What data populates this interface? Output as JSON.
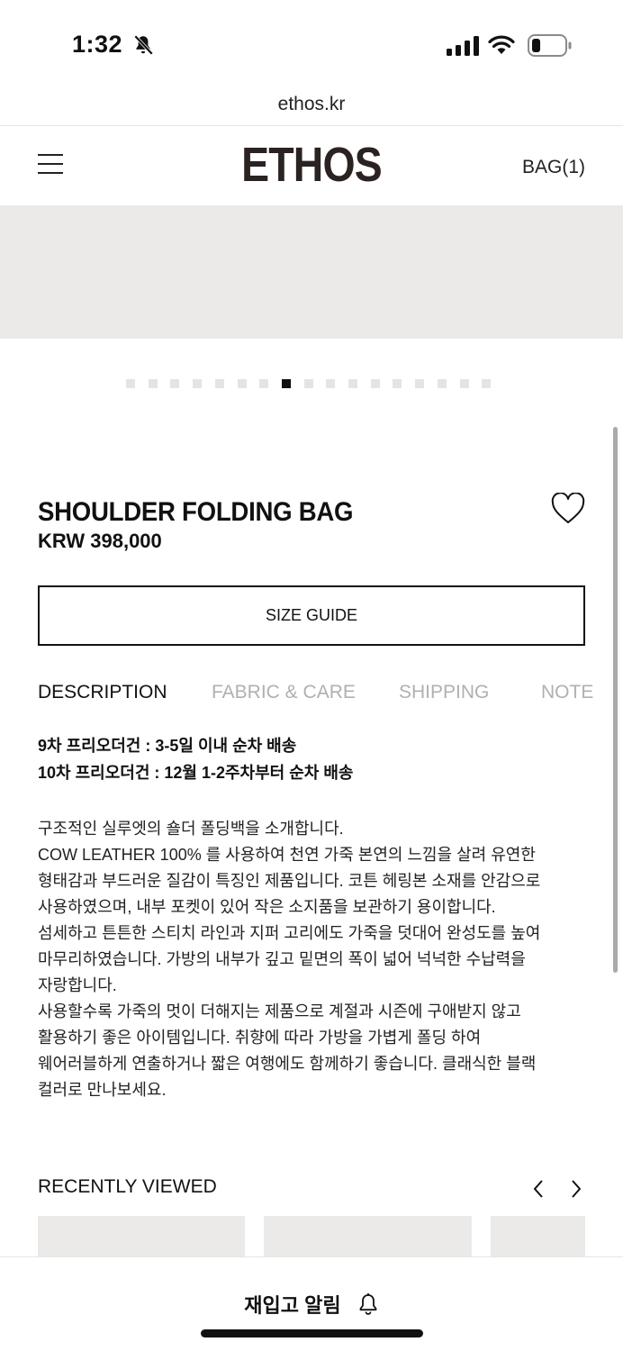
{
  "status_bar": {
    "time": "1:32",
    "icons": [
      "bell-slash-icon",
      "cellular-signal-icon",
      "wifi-icon",
      "battery-low-icon"
    ]
  },
  "browser": {
    "url": "ethos.kr"
  },
  "header": {
    "logo": "ETHOS",
    "bag_label": "BAG(1)",
    "menu_icon": "hamburger-menu-icon"
  },
  "gallery": {
    "dot_count": 17,
    "active_index": 7,
    "colors": {
      "placeholder": "#ebeae8",
      "dot": "#e4e4e4",
      "dot_active": "#111111"
    }
  },
  "product": {
    "name": "SHOULDER FOLDING BAG",
    "price": "KRW 398,000",
    "size_guide_label": "SIZE GUIDE",
    "wishlist_icon": "heart-outline-icon"
  },
  "tabs": [
    {
      "label": "DESCRIPTION",
      "active": true
    },
    {
      "label": "FABRIC & CARE",
      "active": false
    },
    {
      "label": "SHIPPING",
      "active": false
    },
    {
      "label": "NOTE",
      "active": false
    }
  ],
  "description": {
    "preorder_lines": [
      "9차 프리오더건 : 3-5일 이내 순차 배송",
      "10차 프리오더건 : 12월 1-2주차부터 순차 배송"
    ],
    "body_lines": [
      "구조적인 실루엣의 숄더 폴딩백을 소개합니다.",
      "COW LEATHER 100% 를 사용하여 천연 가죽 본연의 느낌을 살려 유연한",
      "형태감과 부드러운 질감이 특징인 제품입니다. 코튼 헤링본 소재를 안감으로",
      "사용하였으며, 내부 포켓이 있어 작은 소지품을 보관하기 용이합니다.",
      "섬세하고 튼튼한 스티치 라인과 지퍼 고리에도 가죽을 덧대어 완성도를 높여",
      "마무리하였습니다. 가방의 내부가 깊고 밑면의 폭이 넓어 넉넉한 수납력을",
      "자랑합니다.",
      "사용할수록 가죽의 멋이 더해지는 제품으로 계절과 시즌에 구애받지 않고",
      "활용하기 좋은 아이템입니다. 취향에 따라 가방을 가볍게 폴딩 하여",
      "웨어러블하게 연출하거나 짧은 여행에도 함께하기 좋습니다. 클래식한 블랙",
      "컬러로 만나보세요."
    ]
  },
  "recently_viewed": {
    "title": "RECENTLY VIEWED",
    "prev_icon": "chevron-left-icon",
    "next_icon": "chevron-right-icon"
  },
  "bottom_bar": {
    "restock_label": "재입고 알림",
    "restock_icon": "bell-icon"
  }
}
